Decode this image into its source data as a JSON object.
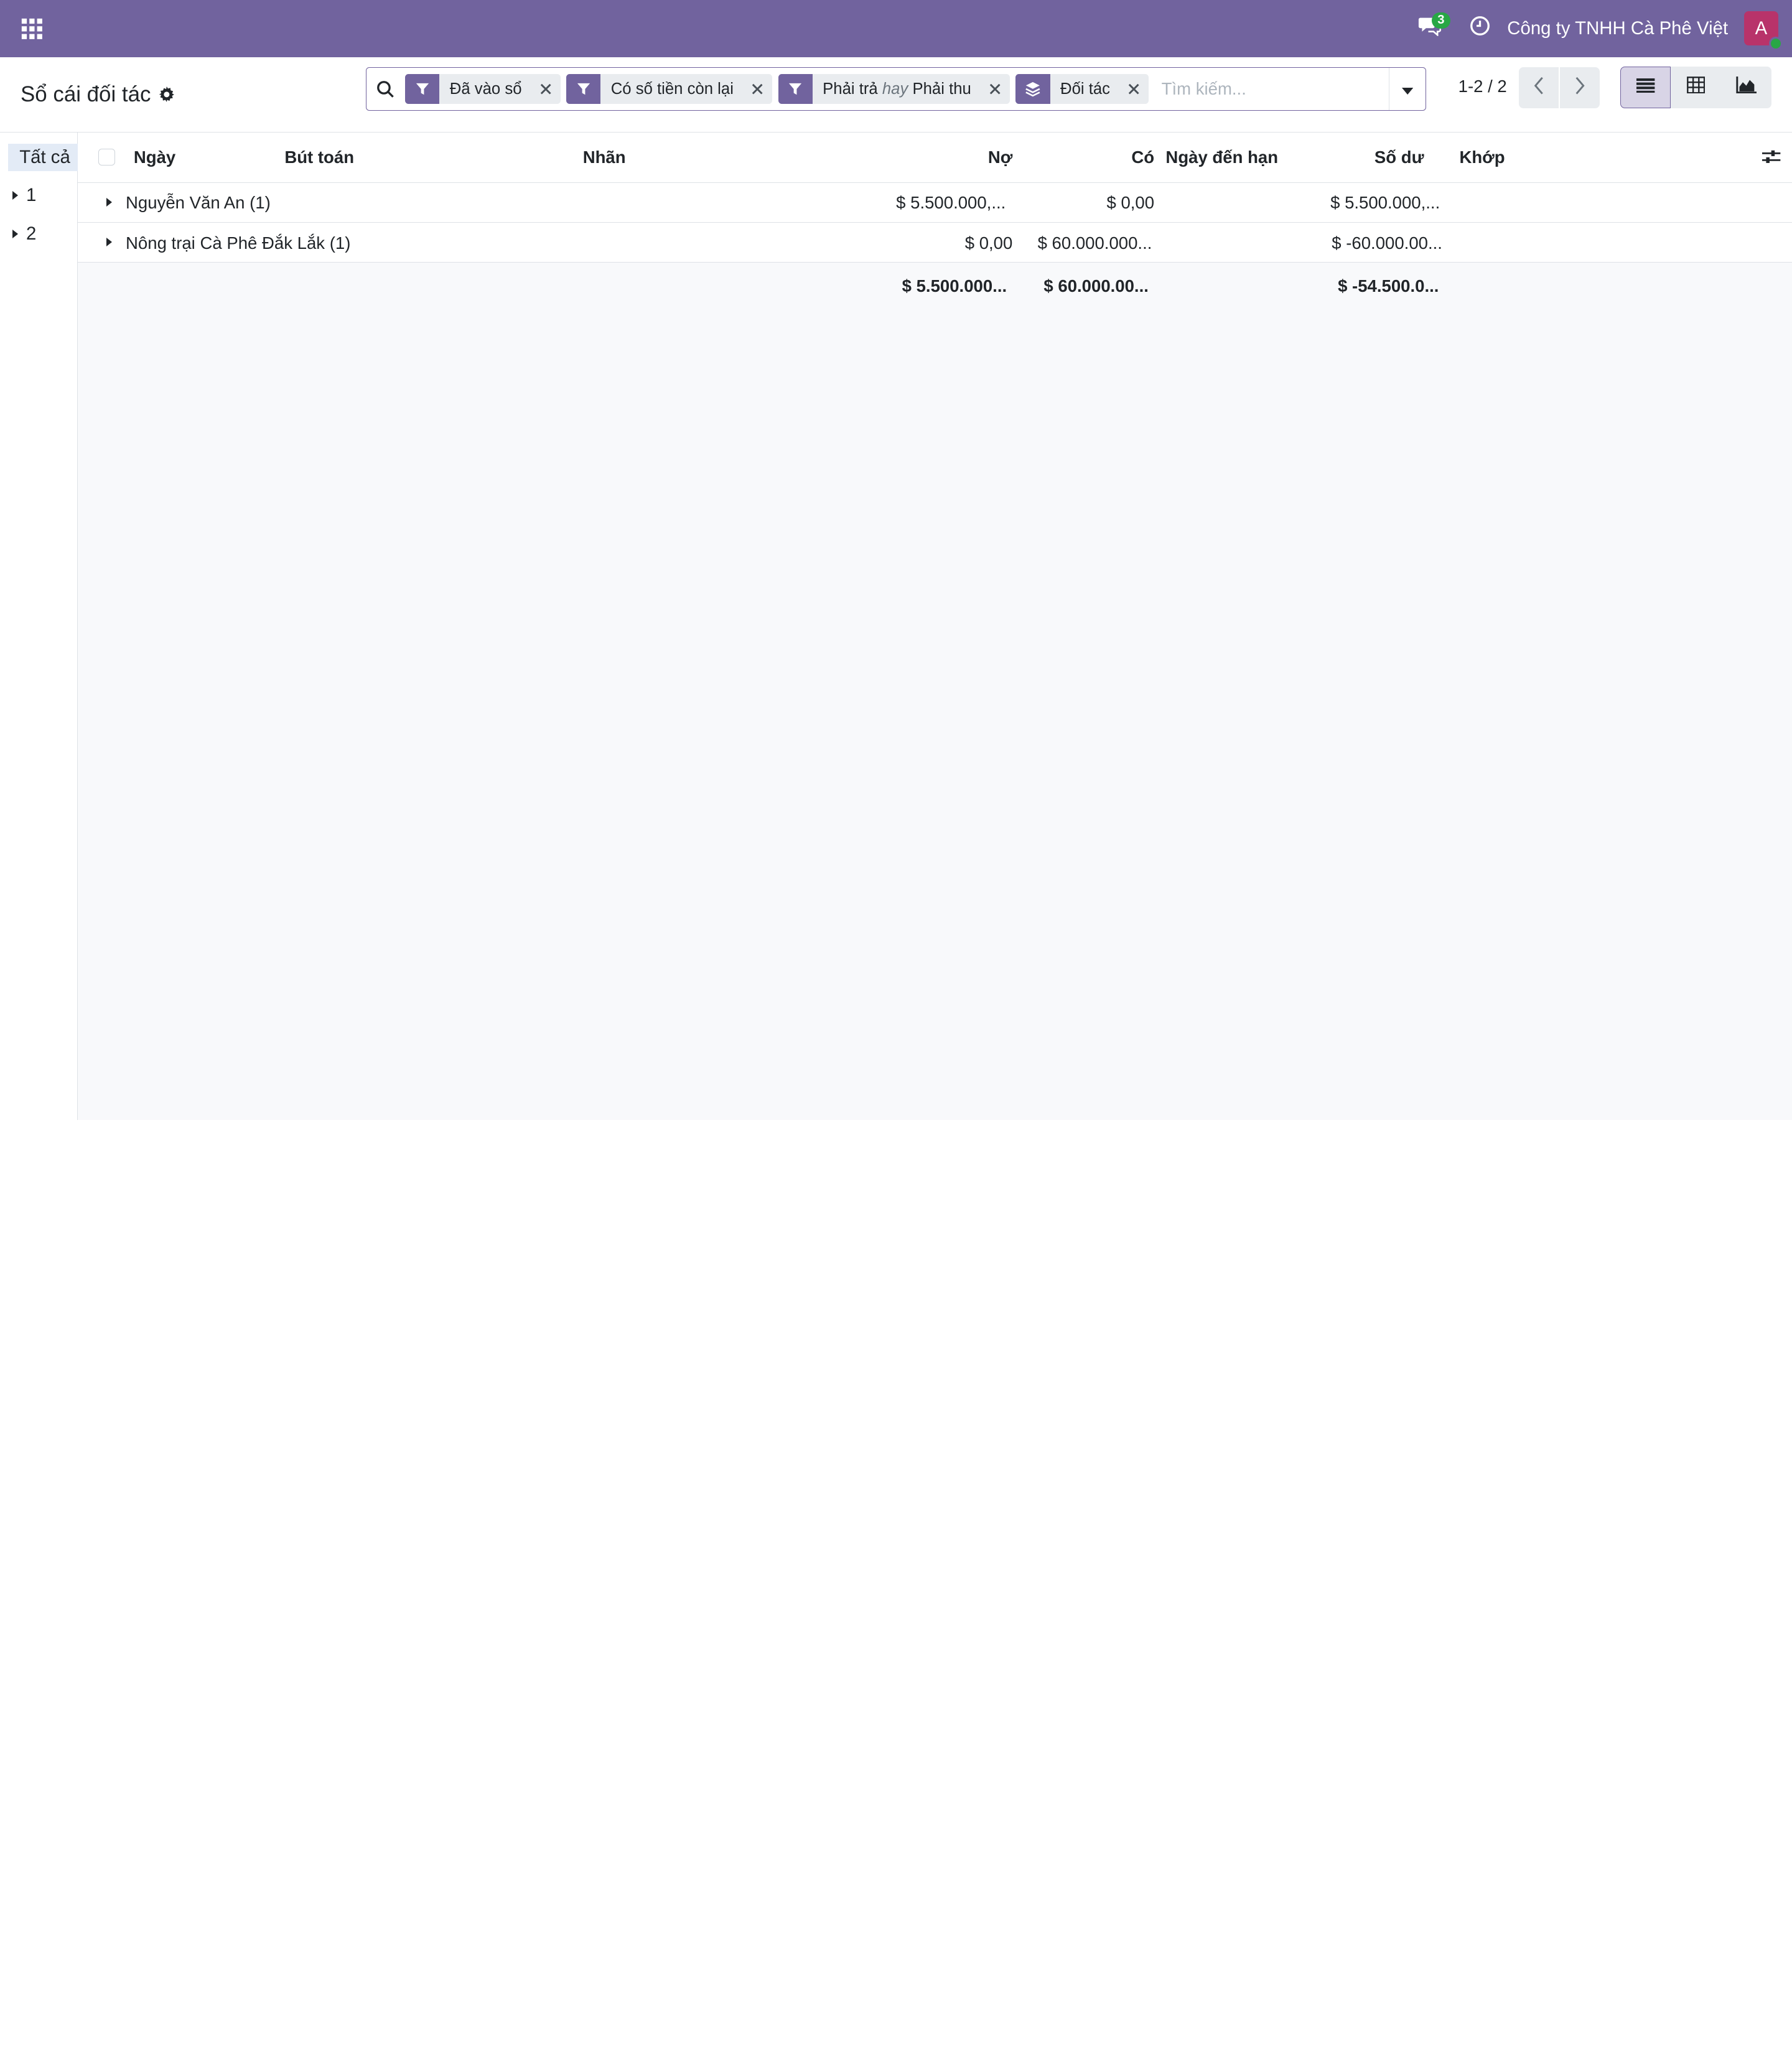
{
  "navbar": {
    "chat_count": "3",
    "company": "Công ty TNHH Cà Phê Việt",
    "avatar_letter": "A",
    "colors": {
      "brand": "#71639e",
      "avatar": "#b8336a",
      "online": "#28a745"
    }
  },
  "control": {
    "title": "Sổ cái đối tác",
    "facets": [
      {
        "icon": "filter-icon",
        "label": "Đã vào sổ"
      },
      {
        "icon": "filter-icon",
        "label": "Có số tiền còn lại"
      },
      {
        "icon": "filter-icon",
        "label_a": "Phải trả",
        "joiner": "hay",
        "label_b": "Phải thu"
      },
      {
        "icon": "layers-icon",
        "label": "Đối tác"
      }
    ],
    "search_placeholder": "Tìm kiếm...",
    "pager": "1-2 / 2"
  },
  "sidepanel": {
    "all_label": "Tất cả",
    "items": [
      "1",
      "2"
    ]
  },
  "table": {
    "columns": {
      "date": "Ngày",
      "entry": "Bút toán",
      "label": "Nhãn",
      "debit": "Nợ",
      "credit": "Có",
      "due_date": "Ngày đến hạn",
      "balance": "Số dư",
      "matching": "Khớp"
    },
    "groups": [
      {
        "name": "Nguyễn Văn An (1)",
        "debit": "$ 5.500.000,...",
        "credit": "$ 0,00",
        "balance": "$ 5.500.000,..."
      },
      {
        "name": "Nông trại Cà Phê Đắk Lắk (1)",
        "debit": "$ 0,00",
        "credit": "$ 60.000.000...",
        "balance": "$ -60.000.00..."
      }
    ],
    "totals": {
      "debit": "$ 5.500.000...",
      "credit": "$ 60.000.00...",
      "balance": "$ -54.500.0..."
    }
  }
}
